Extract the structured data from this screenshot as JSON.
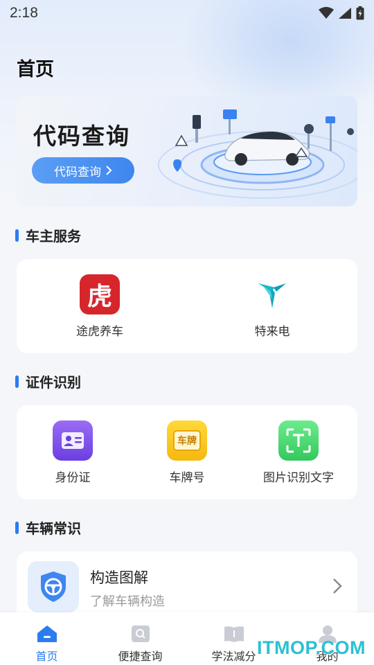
{
  "status_bar": {
    "time": "2:18"
  },
  "page_title": "首页",
  "banner": {
    "title": "代码查询",
    "button_label": "代码查询"
  },
  "sections": {
    "owner_services": {
      "title": "车主服务",
      "items": [
        {
          "label": "途虎养车",
          "icon": "tuhu-tiger-icon",
          "icon_glyph": "虎"
        },
        {
          "label": "特来电",
          "icon": "teld-logo-icon"
        }
      ]
    },
    "id_recognition": {
      "title": "证件识别",
      "items": [
        {
          "label": "身份证",
          "icon": "id-card-icon"
        },
        {
          "label": "车牌号",
          "icon": "license-plate-icon",
          "icon_glyph": "车牌"
        },
        {
          "label": "图片识别文字",
          "icon": "text-scan-icon",
          "icon_glyph": "T"
        }
      ]
    },
    "vehicle_knowledge": {
      "title": "车辆常识",
      "items": [
        {
          "title": "构造图解",
          "subtitle": "了解车辆构造",
          "icon": "steering-wheel-icon"
        }
      ]
    }
  },
  "bottom_nav": [
    {
      "label": "首页",
      "icon": "home-icon",
      "active": true
    },
    {
      "label": "便捷查询",
      "icon": "search-doc-icon",
      "active": false
    },
    {
      "label": "学法减分",
      "icon": "book-icon",
      "active": false
    },
    {
      "label": "我的",
      "icon": "user-icon",
      "active": false
    }
  ],
  "watermark": "ITMOP.COM",
  "colors": {
    "accent": "#2b7cf0",
    "tuhu_red": "#d6262c",
    "id_purple": "#7a4de8",
    "plate_yellow": "#f7c21a",
    "scan_green": "#44d46a"
  }
}
